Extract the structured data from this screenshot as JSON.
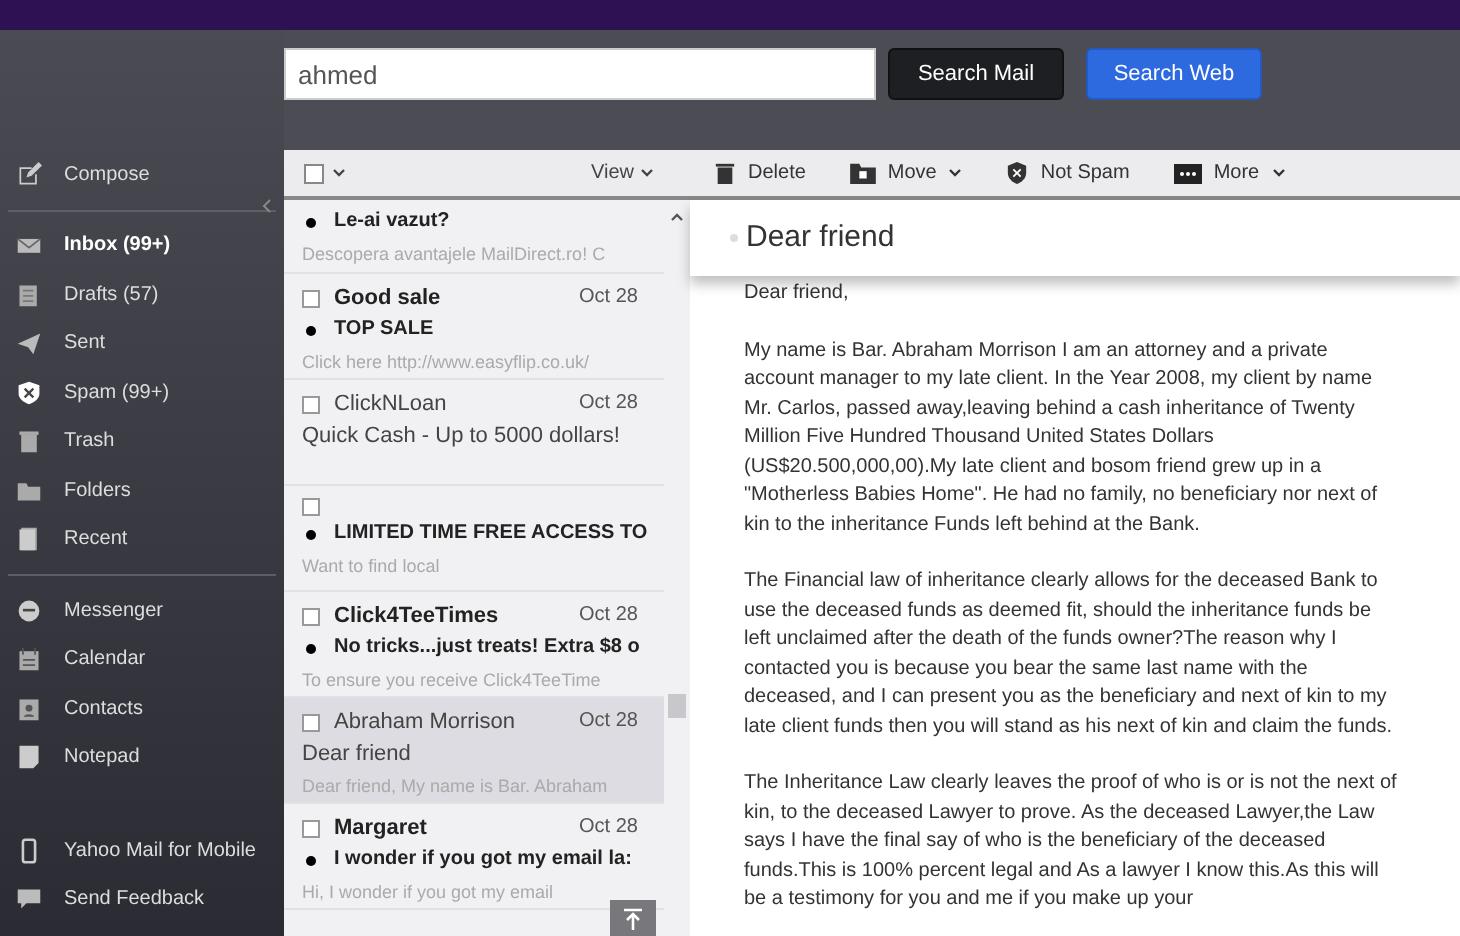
{
  "search": {
    "value": "ahmed",
    "buttons": [
      {
        "label": "Search Mail",
        "kind": "dark"
      },
      {
        "label": "Search Web",
        "kind": "primary"
      }
    ]
  },
  "sidebar": {
    "groups": [
      [
        {
          "label": "Compose",
          "selected": false
        }
      ],
      [
        {
          "label": "Inbox (99+)",
          "selected": true
        },
        {
          "label": "Drafts (57)",
          "selected": false
        },
        {
          "label": "Sent",
          "selected": false
        },
        {
          "label": "Spam (99+)",
          "selected": false
        },
        {
          "label": "Trash",
          "selected": false
        },
        {
          "label": "Folders",
          "selected": false
        },
        {
          "label": "Recent",
          "selected": false
        }
      ],
      [
        {
          "label": "Messenger",
          "selected": false
        },
        {
          "label": "Calendar",
          "selected": false
        },
        {
          "label": "Contacts",
          "selected": false
        },
        {
          "label": "Notepad",
          "selected": false
        }
      ],
      [
        {
          "label": "Yahoo Mail for Mobile",
          "selected": false
        },
        {
          "label": "Send Feedback",
          "selected": false
        }
      ]
    ]
  },
  "list_toolbar": {
    "view": "View",
    "checked": false
  },
  "messages": [
    {
      "kind": "cut",
      "subject": "Le-ai vazut?",
      "preview": "Descopera avantajele MailDirect.ro! C",
      "unread": true,
      "selected": false
    },
    {
      "kind": "full",
      "sender": "Good sale",
      "date": "Oct 28",
      "subject": "TOP SALE",
      "preview": "Click here http://www.easyflip.co.uk/",
      "unread": true,
      "selected": false
    },
    {
      "kind": "full",
      "sender": "ClickNLoan",
      "date": "Oct 28",
      "subject": "Quick Cash - Up to 5000 dollars!",
      "unread": false,
      "selected": false
    },
    {
      "kind": "full",
      "subject": "LIMITED TIME FREE ACCESS TO",
      "preview": "Want to find local",
      "unread": true,
      "selected": false
    },
    {
      "kind": "full",
      "sender": "Click4TeeTimes",
      "date": "Oct 28",
      "subject": "No tricks...just treats! Extra $8 o",
      "preview": "To ensure you receive Click4TeeTime",
      "unread": true,
      "selected": false
    },
    {
      "kind": "full",
      "sender": "Abraham Morrison",
      "date": "Oct 28",
      "subject": "Dear friend",
      "preview": "Dear friend, My name is Bar. Abraham",
      "unread": false,
      "selected": true
    },
    {
      "kind": "full",
      "sender": "Margaret",
      "date": "Oct 28",
      "subject": "I wonder if you got my email la:",
      "preview": "Hi, I wonder if you got my email",
      "unread": true,
      "selected": false
    }
  ],
  "actions": [
    {
      "label": "Delete",
      "caret": false
    },
    {
      "label": "Move",
      "caret": true
    },
    {
      "label": "Not Spam",
      "caret": false
    },
    {
      "label": "More",
      "caret": true
    }
  ],
  "reading": {
    "subject": "Dear friend",
    "paragraphs": [
      "Dear friend,",
      "My name is Bar. Abraham Morrison I am an attorney and a private account manager to my late client. In the Year 2008, my client by name Mr. Carlos, passed away,leaving behind a cash inheritance of Twenty Million Five Hundred Thousand United States Dollars (US$20.500,000,00).My late client and bosom friend grew up in a \"Motherless Babies Home\". He had no family, no beneficiary nor next of kin to the inheritance Funds left behind at the Bank.",
      "The Financial law of inheritance clearly allows for the deceased Bank to use the deceased funds as deemed fit, should the inheritance funds be left unclaimed after the death of the funds owner?The reason why I contacted you is because you bear the same last name with the deceased, and I can present you as the beneficiary and next of kin to my late client funds then you will stand  as his next of kin and claim the funds.",
      "The Inheritance Law clearly leaves the proof of who is or is not the next of kin, to the deceased Lawyer to prove. As the deceased Lawyer,the Law says I have the final say of who is the beneficiary of the deceased funds.This is 100% percent legal and As a lawyer I know this.As this will be a testimony for you and me if you make up your"
    ]
  }
}
